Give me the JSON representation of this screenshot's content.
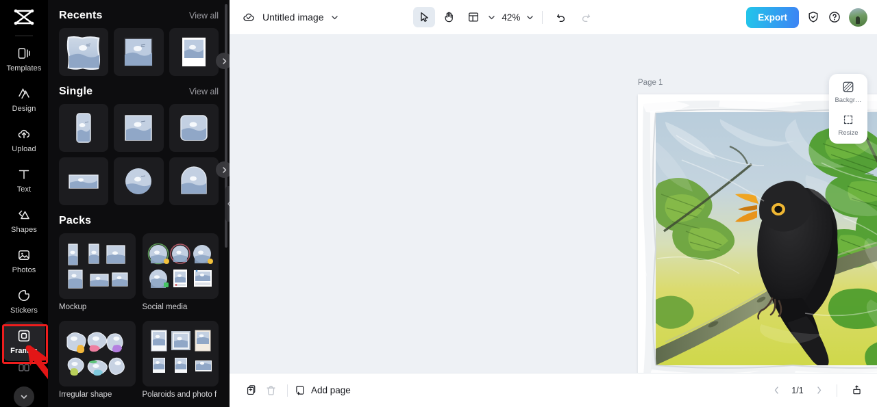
{
  "app": {
    "logo_name": "capcut-logo"
  },
  "sidebar": {
    "items": [
      {
        "label": "Templates",
        "icon": "templates-icon",
        "active": false
      },
      {
        "label": "Design",
        "icon": "design-icon",
        "active": false
      },
      {
        "label": "Upload",
        "icon": "upload-cloud-icon",
        "active": false
      },
      {
        "label": "Text",
        "icon": "text-icon",
        "active": false
      },
      {
        "label": "Shapes",
        "icon": "shapes-icon",
        "active": false
      },
      {
        "label": "Photos",
        "icon": "photos-icon",
        "active": false
      },
      {
        "label": "Stickers",
        "icon": "stickers-icon",
        "active": false
      },
      {
        "label": "Frames",
        "icon": "frames-icon",
        "active": true
      }
    ],
    "more_icon": "chevron-down-icon",
    "highlight_color": "#ee1d1d"
  },
  "panel": {
    "sections": [
      {
        "title": "Recents",
        "view_all": "View all"
      },
      {
        "title": "Single",
        "view_all": "View all"
      },
      {
        "title": "Packs",
        "view_all": ""
      }
    ],
    "packs": [
      {
        "label": "Mockup"
      },
      {
        "label": "Social media"
      },
      {
        "label": "Irregular shape"
      },
      {
        "label": "Polaroids and photo f"
      }
    ],
    "next_icon": "chevron-right-icon",
    "collapse_icon": "chevron-left-icon"
  },
  "toolbar": {
    "cloud_icon": "cloud-saved-icon",
    "title": "Untitled image",
    "title_chevron": "chevron-down-icon",
    "select_tool": "cursor-select-icon",
    "hand_tool": "hand-pan-icon",
    "layout_tool": "layout-grid-icon",
    "zoom_level": "42%",
    "zoom_chevron": "chevron-down-icon",
    "undo_icon": "undo-icon",
    "redo_icon": "redo-icon",
    "export_label": "Export",
    "shield_icon": "shield-check-icon",
    "help_icon": "help-circle-icon",
    "avatar": "user-avatar"
  },
  "canvas": {
    "page_label": "Page 1",
    "duplicate_icon": "duplicate-page-icon",
    "more_icon": "more-options-icon",
    "artwork_alt": "blackbird-on-branch-plastic-wrap-frame"
  },
  "float_panel": {
    "items": [
      {
        "label": "Backgr…",
        "icon": "background-icon"
      },
      {
        "label": "Resize",
        "icon": "resize-icon"
      }
    ]
  },
  "bottombar": {
    "duplicate_icon": "duplicate-icon",
    "delete_icon": "trash-icon",
    "add_page_label": "Add page",
    "add_page_icon": "add-page-icon",
    "prev_icon": "chevron-left-icon",
    "page_indicator": "1/1",
    "next_icon": "chevron-right-icon",
    "export_page_icon": "export-page-icon"
  }
}
